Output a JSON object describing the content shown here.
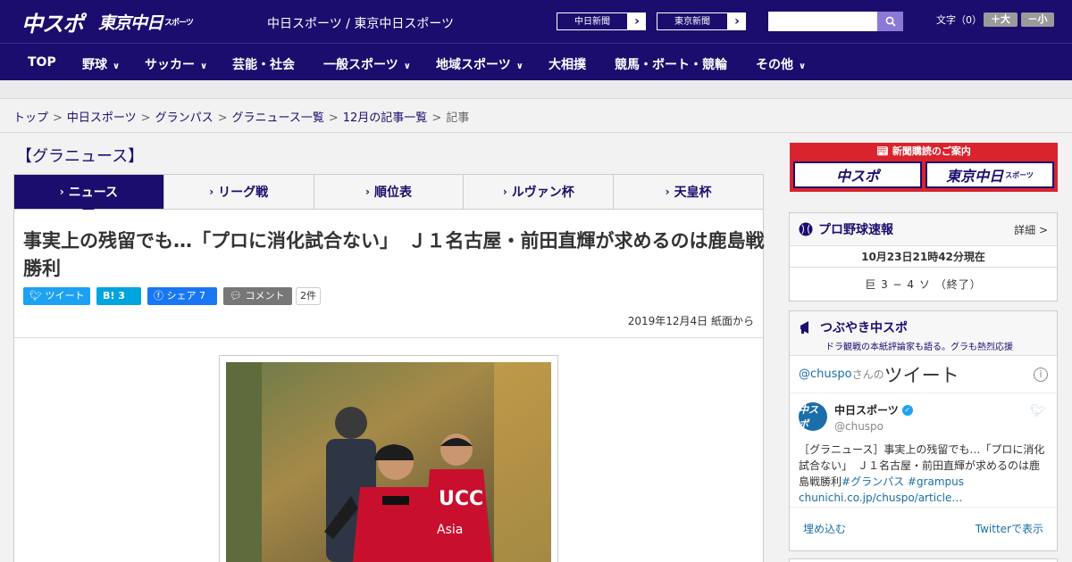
{
  "header": {
    "logo_main": "中スポ",
    "logo_tokyo": "東京中日",
    "logo_tokyo_suffix": "スポーツ",
    "site_name": "中日スポーツ / 東京中日スポーツ",
    "paper_button_1": "中日新聞",
    "paper_button_2": "東京新聞",
    "search_placeholder": "",
    "font_size_label": "文字（0）",
    "font_larger": "＋大",
    "font_smaller": "－小"
  },
  "nav": {
    "items": [
      {
        "label": "TOP"
      },
      {
        "label": "野球"
      },
      {
        "label": "サッカー"
      },
      {
        "label": "芸能・社会"
      },
      {
        "label": "一般スポーツ"
      },
      {
        "label": "地域スポーツ"
      },
      {
        "label": "大相撲"
      },
      {
        "label": "競馬・ボート・競輪"
      },
      {
        "label": "その他"
      }
    ]
  },
  "breadcrumb": {
    "items": [
      "トップ",
      "中日スポーツ",
      "グランパス",
      "グラニュース一覧",
      "12月の記事一覧",
      "記事"
    ]
  },
  "section_title": "【グラニュース】",
  "tabs": [
    {
      "label": "ニュース"
    },
    {
      "label": "リーグ戦"
    },
    {
      "label": "順位表"
    },
    {
      "label": "ルヴァン杯"
    },
    {
      "label": "天皇杯"
    }
  ],
  "article": {
    "headline": "事実上の残留でも…「プロに消化試合ない」　Ｊ１名古屋・前田直輝が求めるのは鹿島戦勝利",
    "share": {
      "tweet": "ツイート",
      "hatena_count": "3",
      "facebook": "シェア",
      "facebook_count": "7",
      "comment": "コメント",
      "comment_count": "2件"
    },
    "date": "2019年12月4日 紙面から"
  },
  "sidebar": {
    "subscription_title": "新聞購読のご案内",
    "subscription_logo_1": "中スポ",
    "subscription_logo_2": "東京中日",
    "subscription_logo_2_suffix": "スポーツ",
    "baseball": {
      "title": "プロ野球速報",
      "more": "詳細 >",
      "updated": "10月23日21時42分現在",
      "score": "巨 3 − 4 ソ （終了）"
    },
    "tweets": {
      "title": "つぶやき中スポ",
      "subtitle": "ドラ観戦の本紙評論家も語る。グラも熱烈応援",
      "handle": "@chuspo",
      "handle_suffix": "さんの",
      "tweets_label": "ツイート",
      "author_name": "中日スポーツ",
      "author_user": "@chuspo",
      "avatar_text": "中スポ",
      "tweet_text": "［グラニュース］事実上の残留でも…「プロに消化試合ない」　Ｊ１名古屋・前田直輝が求めるのは鹿島戦勝利",
      "tweet_hashtags": "#グランパス #grampus",
      "tweet_link": "chunichi.co.jp/chuspo/article…",
      "embed": "埋め込む",
      "view_on_twitter": "Twitterで表示"
    }
  },
  "colors": {
    "brand_navy": "#1b0d6e",
    "subscription_red": "#d9232d",
    "twitter_blue": "#1da1f2",
    "facebook_blue": "#1877f2",
    "hatena_blue": "#00a4de"
  }
}
